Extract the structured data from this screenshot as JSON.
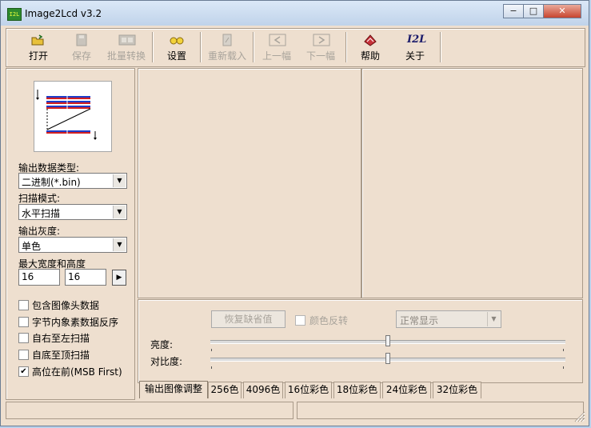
{
  "window": {
    "title": "Image2Lcd v3.2",
    "icon_text": "I2L"
  },
  "titlebar_buttons": {
    "minimize": "−",
    "maximize": "□",
    "close": "✕"
  },
  "toolbar": {
    "open": "打开",
    "save": "保存",
    "batch": "批量转换",
    "settings": "设置",
    "reload": "重新载入",
    "prev": "上一幅",
    "next": "下一幅",
    "help": "帮助",
    "about": "关于"
  },
  "left": {
    "output_type_label": "输出数据类型:",
    "output_type_value": "二进制(*.bin)",
    "scan_mode_label": "扫描模式:",
    "scan_mode_value": "水平扫描",
    "gray_label": "输出灰度:",
    "gray_value": "单色",
    "size_label": "最大宽度和高度",
    "width": "16",
    "height": "16",
    "options": [
      {
        "label": "包含图像头数据",
        "checked": false
      },
      {
        "label": "字节内象素数据反序",
        "checked": false
      },
      {
        "label": "自右至左扫描",
        "checked": false
      },
      {
        "label": "自底至顶扫描",
        "checked": false
      },
      {
        "label": "高位在前(MSB First)",
        "checked": true
      }
    ]
  },
  "adjust": {
    "restore": "恢复缺省值",
    "invert": "颜色反转",
    "display_mode": "正常显示",
    "brightness_label": "亮度:",
    "brightness": 0.5,
    "contrast_label": "对比度:",
    "contrast": 0.5
  },
  "tabs": [
    "输出图像调整",
    "256色",
    "4096色",
    "16位彩色",
    "18位彩色",
    "24位彩色",
    "32位彩色"
  ],
  "colors": {
    "panel_bg": "#eedfcf",
    "titlebar": "#c6d8ee",
    "close_btn": "#c8452f"
  }
}
